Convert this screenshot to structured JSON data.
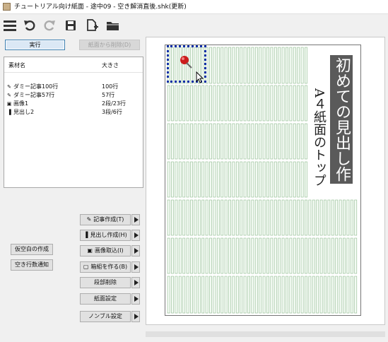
{
  "window": {
    "title": "チュートリアル向け紙面 - 途中09 - 空き解消直後.shk(更新)"
  },
  "toolbar": {
    "icons": [
      "menu-icon",
      "undo-icon",
      "redo-icon",
      "save-icon",
      "new-page-icon",
      "open-folder-icon"
    ]
  },
  "actions": {
    "execute_label": "実行",
    "remove_from_page_label": "紙面から削除(D)"
  },
  "material_list": {
    "headers": {
      "name": "素材名",
      "size": "大きさ"
    },
    "rows": [
      {
        "icon": "pencil-icon",
        "name": "ダミー記事100行",
        "size": "100行"
      },
      {
        "icon": "pencil-icon",
        "name": "ダミー記事57行",
        "size": "57行"
      },
      {
        "icon": "image-icon",
        "name": "画像1",
        "size": "2段/23行"
      },
      {
        "icon": "headline-icon",
        "name": "見出し2",
        "size": "3段/6行"
      }
    ]
  },
  "left_buttons": {
    "create_blank_label": "仮空白の作成",
    "empty_lines_label": "空き行数通知"
  },
  "action_buttons": [
    {
      "icon": "pencil-icon",
      "label": "記事作成(T)"
    },
    {
      "icon": "headline-icon",
      "label": "見出し作成(H)"
    },
    {
      "icon": "image-icon",
      "label": "画像取込(I)"
    },
    {
      "icon": "box-icon",
      "label": "箱組を作る(B)"
    },
    {
      "icon": "",
      "label": "段部削除"
    },
    {
      "icon": "",
      "label": "紙面設定"
    },
    {
      "icon": "",
      "label": "ノンブル設定"
    }
  ],
  "page": {
    "headline": "初めての見出し作り",
    "subheadline": "A４紙面のトップ"
  },
  "colors": {
    "grid_line": "#8bb88b",
    "selection": "#1030a8",
    "headline_bg": "#5a5a5a",
    "pin": "#cc1d1d"
  }
}
